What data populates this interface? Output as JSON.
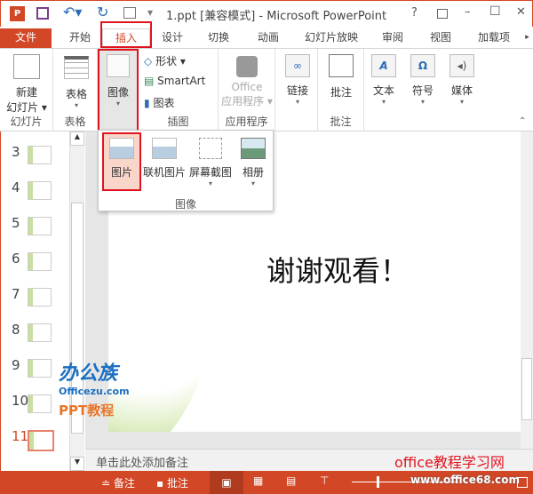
{
  "window": {
    "title": "1.ppt [兼容模式] - Microsoft PowerPoint",
    "help": "?",
    "minimize": "–",
    "maximize": "☐",
    "close": "✕"
  },
  "tabs": [
    {
      "label": "文件"
    },
    {
      "label": "开始"
    },
    {
      "label": "插入"
    },
    {
      "label": "设计"
    },
    {
      "label": "切换"
    },
    {
      "label": "动画"
    },
    {
      "label": "幻灯片放映"
    },
    {
      "label": "审阅"
    },
    {
      "label": "视图"
    },
    {
      "label": "加载项"
    }
  ],
  "ribbon": {
    "new_slide": "新建\n幻灯片",
    "new_slide_l1": "新建",
    "new_slide_l2": "幻灯片 ▾",
    "group_slides": "幻灯片",
    "table": "表格",
    "group_table": "表格",
    "images": "图像",
    "shapes": "形状 ▾",
    "smartart": "SmartArt",
    "chart": "图表",
    "group_illustrations": "插图",
    "office_l1": "Office",
    "office_l2": "应用程序 ▾",
    "group_apps": "应用程序",
    "links": "链接",
    "comment": "批注",
    "group_comments": "批注",
    "text": "文本",
    "symbols": "符号",
    "media": "媒体"
  },
  "dropdown": {
    "items": [
      {
        "label": "图片"
      },
      {
        "label": "联机图片"
      },
      {
        "label": "屏幕截图"
      },
      {
        "label": "相册"
      }
    ],
    "group": "图像"
  },
  "slides": {
    "numbers": [
      "3",
      "4",
      "5",
      "6",
      "7",
      "8",
      "9",
      "10",
      "11"
    ],
    "selected": "11"
  },
  "slide": {
    "text": "谢谢观看！"
  },
  "notes": {
    "placeholder": "单击此处添加备注"
  },
  "status": {
    "notes": "备注",
    "comments": "批注"
  },
  "watermarks": {
    "logo_cn": "办公族",
    "logo_en": "Officezu.com",
    "logo_ppt": "PPT教程",
    "site": "office教程学习网",
    "url": "www.office68.com"
  },
  "colors": {
    "accent": "#d24726",
    "highlight": "#e0141e"
  }
}
